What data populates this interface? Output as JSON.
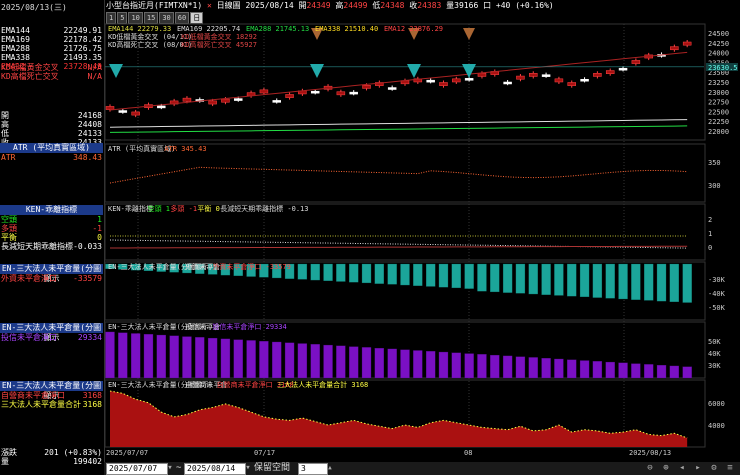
{
  "left": {
    "date": "2025/08/13(三)",
    "ma_rows": [
      {
        "label": "EMA144",
        "value": "22249.91",
        "color": "#ffffff"
      },
      {
        "label": "EMA169",
        "value": "22178.42",
        "color": "#ffffff"
      },
      {
        "label": "EMA288",
        "value": "21726.75",
        "color": "#ffffff"
      },
      {
        "label": "EMA338",
        "value": "21493.35",
        "color": "#ffffff"
      },
      {
        "label": "EMA12",
        "value": "23728.49",
        "color": "#ff3333"
      }
    ],
    "kd_rows": [
      {
        "label": "KD低檔黃金交叉",
        "value": "N/A"
      },
      {
        "label": "KD高檔死亡交叉",
        "value": "N/A"
      }
    ],
    "ohlc_rows": [
      {
        "label": "開",
        "value": "24168"
      },
      {
        "label": "高",
        "value": "24408"
      },
      {
        "label": "低",
        "value": "24133"
      },
      {
        "label": "收",
        "value": "24133"
      }
    ],
    "atr_header": "ATR (平均真實區域)",
    "atr_label": "ATR",
    "atr_value": "348.43",
    "ken_header": "KEN-乖離指標",
    "ken_rows": [
      {
        "label": "空頭",
        "value": "1",
        "color": "#22ee22"
      },
      {
        "label": "多頭",
        "value": "-1",
        "color": "#ff4444"
      },
      {
        "label": "平衡",
        "value": "0",
        "color": "#ffff44"
      },
      {
        "label": "長減短天期乖離指標",
        "value": "-0.033",
        "color": "#ffffff"
      }
    ],
    "en1_header": "EN-三大法人未平倉量(分圖顯示",
    "en1_label": "外資未平倉淨口",
    "en1_value": "-33579",
    "en2_header": "EN-三大法人未平倉量(分圖顯示",
    "en2_label": "投信未平倉淨口",
    "en2_value": "29334",
    "en3_header": "EN-三大法人未平倉量(分圖顯示",
    "en3_rows": [
      {
        "label": "自營商未平倉淨口",
        "value": "3168",
        "color": "#ff4444"
      },
      {
        "label": "三大法人未平倉量合計",
        "value": "3168",
        "color": "#ffff44"
      }
    ],
    "vol_rows": [
      {
        "label": "漲跌",
        "value": "201 (+0.83%)"
      },
      {
        "label": "量",
        "value": "199402"
      }
    ]
  },
  "header": {
    "symbol": "小型台指近月(FIMTXN*1)",
    "chart_type": "日線圖",
    "date": "2025/08/14",
    "open_label": "開",
    "open": "24349",
    "high_label": "高",
    "high": "24499",
    "low_label": "低",
    "low": "24348",
    "close_label": "收",
    "close": "24383",
    "volume_label": "量",
    "volume": "39166",
    "change_label": "口",
    "change": "+40 (+0.16%)"
  },
  "periods": [
    {
      "label": "1",
      "active": false
    },
    {
      "label": "5",
      "active": false
    },
    {
      "label": "10",
      "active": false
    },
    {
      "label": "15",
      "active": false
    },
    {
      "label": "30",
      "active": false
    },
    {
      "label": "60",
      "active": false
    },
    {
      "label": "日",
      "active": true
    }
  ],
  "legend_main": [
    {
      "text": "EMA144 22279.33",
      "color": "#dddd44"
    },
    {
      "text": "EMA169 22205.74",
      "color": "#dddddd"
    },
    {
      "text": "EMA288 21745.13",
      "color": "#22dd44"
    },
    {
      "text": "EMA338 21510.40",
      "color": "#ffdd22"
    },
    {
      "text": "EMA12 23876.29",
      "color": "#ff4444"
    },
    {
      "text": "KD低檔黃金交叉 (04/11)",
      "color": "#dddddd"
    },
    {
      "text": "KD低檔黃金交叉 18292",
      "color": "#dd4444"
    },
    {
      "text": "KD高檔死亡交叉 (08/01)",
      "color": "#dddddd"
    },
    {
      "text": "KD高檔死亡交叉 45927",
      "color": "#dd4444"
    }
  ],
  "atr_legend": [
    {
      "text": "ATR (平均真實區域)",
      "color": "#dddddd"
    },
    {
      "text": "ATR 345.43",
      "color": "#ff6633"
    }
  ],
  "ken_legend": [
    {
      "text": "KEN-乖離指標",
      "color": "#dddddd"
    },
    {
      "text": "空頭 1",
      "color": "#22ee22"
    },
    {
      "text": "多頭 -1",
      "color": "#ff4444"
    },
    {
      "text": "平衡 0",
      "color": "#ffff44"
    },
    {
      "text": "長減短天期乖離指標 -0.13",
      "color": "#dddddd"
    }
  ],
  "en1_legend": [
    {
      "text": "EN-三大法人未平倉量(分圖顯示)",
      "color": "#dddddd"
    },
    {
      "text": "外資未平倉",
      "color": "#dddddd"
    },
    {
      "text": "外資未平倉淨口 -33579",
      "color": "#ff4444"
    }
  ],
  "en2_legend": [
    {
      "text": "EN-三大法人未平倉量(分圖顯示)",
      "color": "#dddddd"
    },
    {
      "text": "投信未平倉",
      "color": "#dddddd"
    },
    {
      "text": "投信未平倉淨口 29334",
      "color": "#aa44ff"
    }
  ],
  "en3_legend": [
    {
      "text": "EN-三大法人未平倉量(分圖顯示)",
      "color": "#dddddd"
    },
    {
      "text": "自營商未平倉",
      "color": "#dddddd"
    },
    {
      "text": "自營商未平倉淨口 3168",
      "color": "#ff4444"
    },
    {
      "text": "三大法人未平倉量合計 3168",
      "color": "#ffff44"
    }
  ],
  "y_axes": {
    "main": [
      "24500",
      "24250",
      "24000",
      "23750",
      "23500",
      "23250",
      "23000",
      "22750",
      "22500",
      "22250",
      "22000"
    ],
    "main_tag": "23630.5",
    "atr": [
      "350",
      "300"
    ],
    "ken": [
      "2",
      "1",
      "0"
    ],
    "en1": [
      "-30K",
      "-40K",
      "-50K"
    ],
    "en2": [
      "50K",
      "40K",
      "30K"
    ],
    "en3": [
      "6000",
      "4000"
    ]
  },
  "x_axis": [
    "2025/07/07",
    "07/17",
    "08",
    "2025/08/13"
  ],
  "bottom": {
    "start_date": "2025/07/07",
    "end_date": "2025/08/14",
    "space_label": "保留空間",
    "space_value": "3"
  },
  "colors": {
    "up": "#aa1111",
    "down": "#ffffff",
    "en1": "#1ba59a",
    "en2": "#7a10c4",
    "en3": "#aa1111",
    "accent": "#1c3a8a"
  }
}
